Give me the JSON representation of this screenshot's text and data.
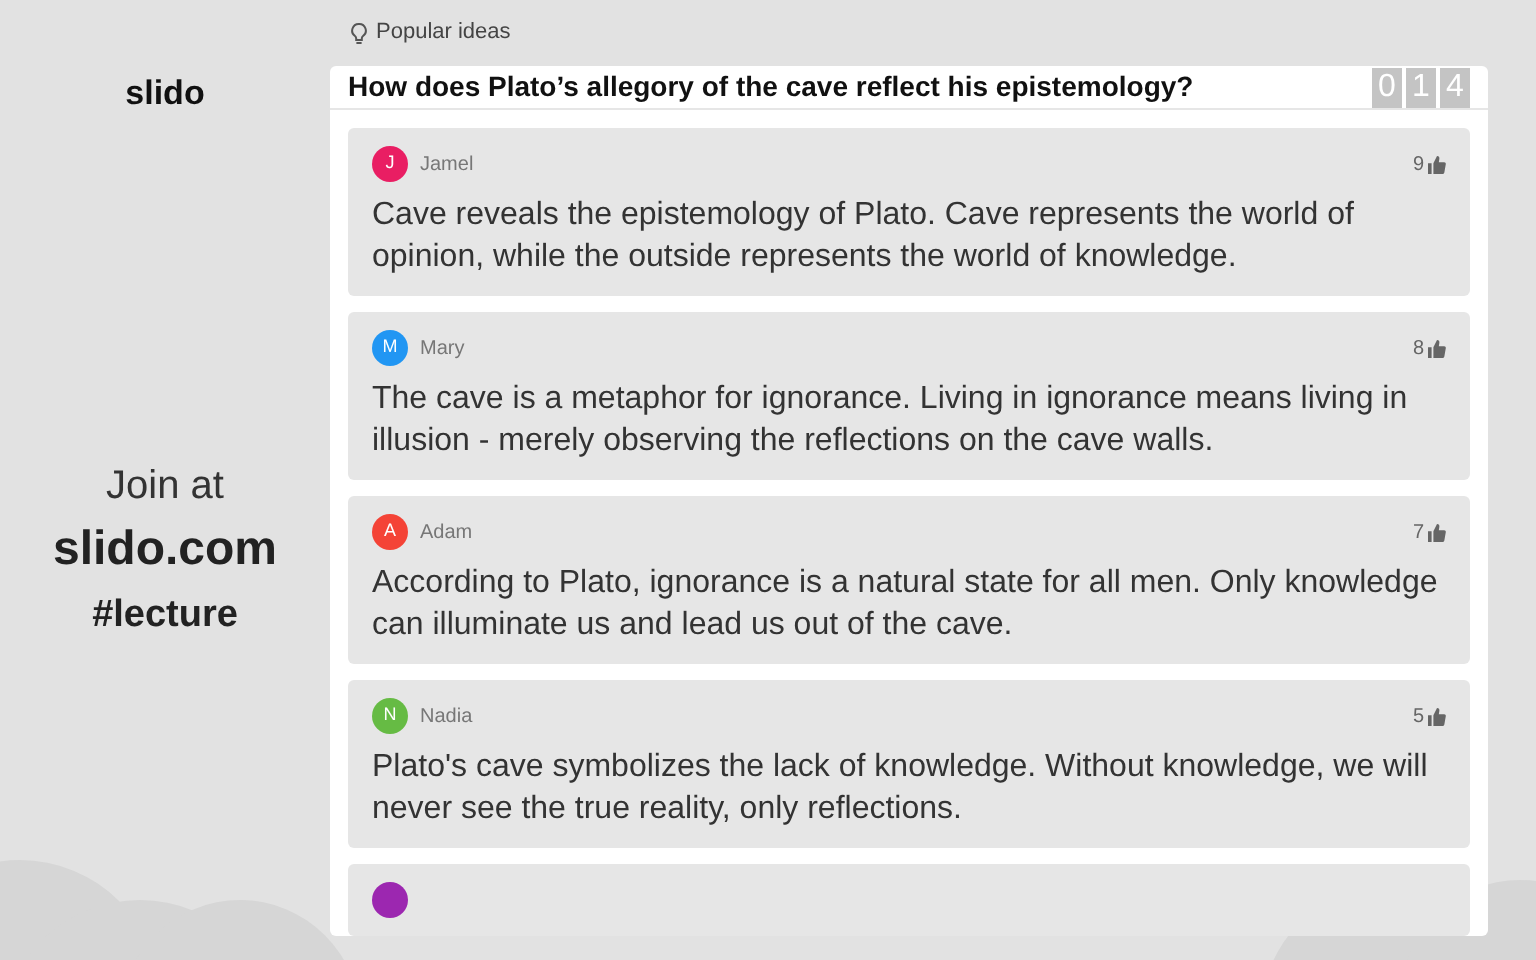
{
  "section_label": "Popular ideas",
  "brand": "slido",
  "join": {
    "line1": "Join at",
    "site": "slido.com",
    "code": "#lecture"
  },
  "question": {
    "text": "How does Plato’s allegory of the cave reflect his epistemology?",
    "counter": [
      "0",
      "1",
      "4"
    ]
  },
  "ideas": [
    {
      "initial": "J",
      "author": "Jamel",
      "color": "#e91e63",
      "likes": "9",
      "text": "Cave reveals the epistemology of Plato. Cave represents the world of opinion, while the outside represents the world of knowledge."
    },
    {
      "initial": "M",
      "author": "Mary",
      "color": "#2196f3",
      "likes": "8",
      "text": "The cave is a metaphor for ignorance. Living in ignorance means living in illusion - merely observing the reflections on the cave walls."
    },
    {
      "initial": "A",
      "author": "Adam",
      "color": "#f44336",
      "likes": "7",
      "text": "According to Plato, ignorance is a natural state for all men. Only knowledge can illuminate us and lead us out of the cave."
    },
    {
      "initial": "N",
      "author": "Nadia",
      "color": "#66bb44",
      "likes": "5",
      "text": "Plato's cave symbolizes the lack of knowledge. Without knowledge, we will never see the true reality, only reflections."
    },
    {
      "color": "#9c27b0"
    }
  ]
}
